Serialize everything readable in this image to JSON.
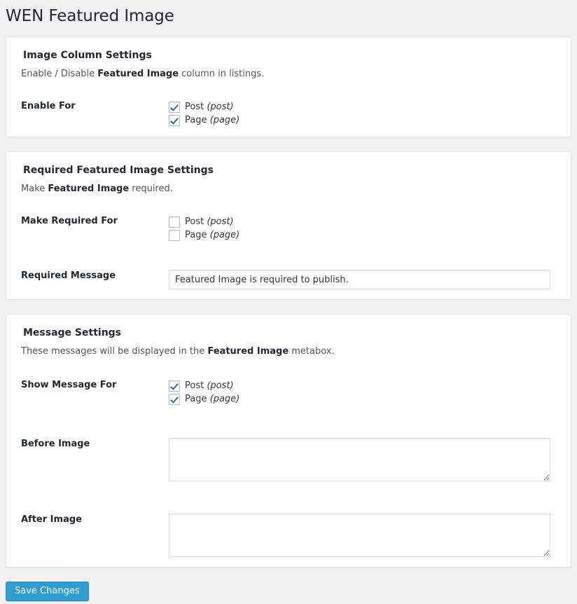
{
  "page": {
    "title": "WEN Featured Image"
  },
  "sections": [
    {
      "heading": "Image Column Settings",
      "desc_before": "Enable / Disable ",
      "desc_strong": "Featured Image",
      "desc_after": " column in listings.",
      "rows": [
        {
          "label": "Enable For",
          "options": [
            {
              "name": "Post",
              "slug": "(post)",
              "checked": true
            },
            {
              "name": "Page",
              "slug": "(page)",
              "checked": true
            }
          ]
        }
      ]
    },
    {
      "heading": "Required Featured Image Settings",
      "desc_before": "Make ",
      "desc_strong": "Featured Image",
      "desc_after": " required.",
      "rows": [
        {
          "label": "Make Required For",
          "options": [
            {
              "name": "Post",
              "slug": "(post)",
              "checked": false
            },
            {
              "name": "Page",
              "slug": "(page)",
              "checked": false
            }
          ]
        },
        {
          "label": "Required Message",
          "input_value": "Featured Image is required to publish.",
          "input_placeholder": ""
        }
      ]
    },
    {
      "heading": "Message Settings",
      "desc_before": "These messages will be displayed in the ",
      "desc_strong": "Featured Image",
      "desc_after": " metabox.",
      "rows": [
        {
          "label": "Show Message For",
          "options": [
            {
              "name": "Post",
              "slug": "(post)",
              "checked": true
            },
            {
              "name": "Page",
              "slug": "(page)",
              "checked": true
            }
          ]
        },
        {
          "label": "Before Image",
          "textarea_value": "",
          "textarea_placeholder": ""
        },
        {
          "label": "After Image",
          "textarea_value": "",
          "textarea_placeholder": ""
        }
      ]
    }
  ],
  "submit": {
    "label": "Save Changes"
  },
  "colors": {
    "page_background": "#f1f1f1",
    "card_background": "#ffffff",
    "card_border": "#e5e5e5",
    "title_text": "#23282d",
    "checkbox_check": "#2271b1",
    "checkbox_border": "#b4b9be",
    "button_background": "#2e9fd0",
    "button_border": "#2089ba",
    "button_text": "#ffffff"
  }
}
